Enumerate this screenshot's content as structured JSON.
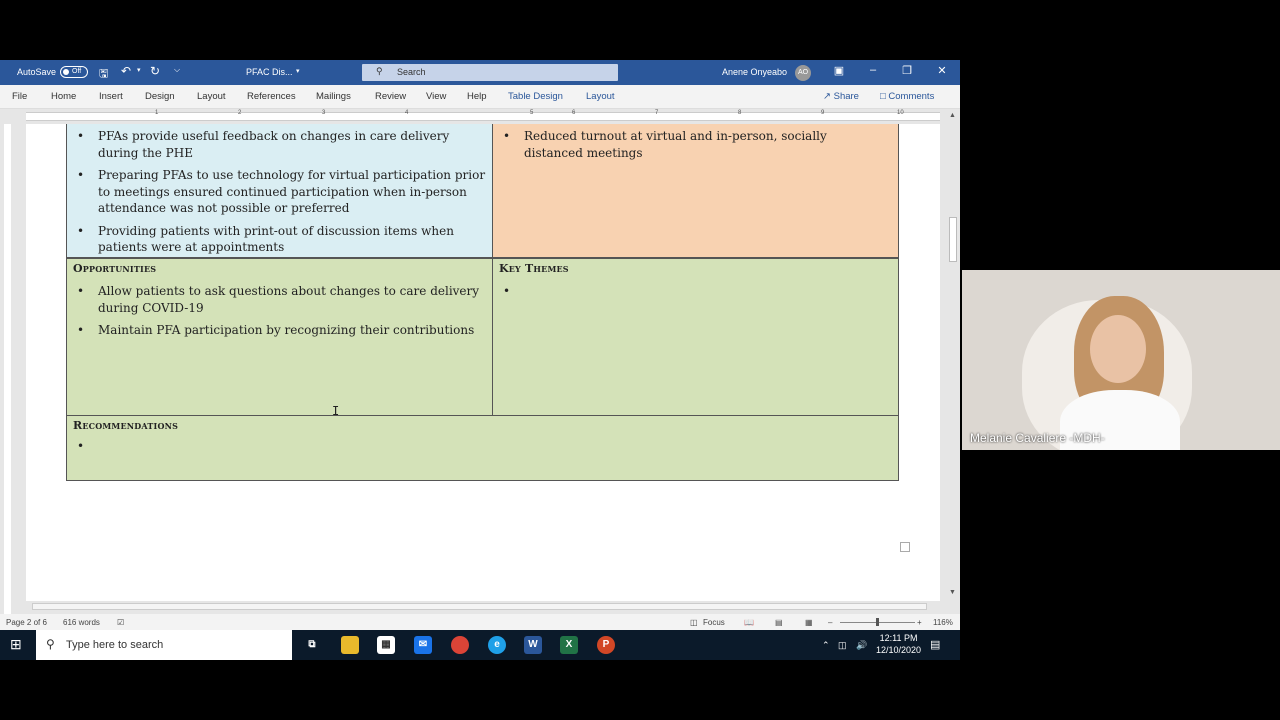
{
  "titlebar": {
    "autosave": "AutoSave",
    "autosave_state": "Off",
    "doc_name": "PFAC Dis...",
    "search_placeholder": "Search",
    "user_name": "Anene Onyeabo",
    "user_initials": "AO"
  },
  "ribbon": {
    "tabs": [
      "File",
      "Home",
      "Insert",
      "Design",
      "Layout",
      "References",
      "Mailings",
      "Review",
      "View",
      "Help",
      "Table Design",
      "Layout"
    ],
    "share": "Share",
    "comments": "Comments"
  },
  "ruler_numbers": [
    "1",
    "2",
    "3",
    "4",
    "5",
    "6",
    "7",
    "8",
    "9",
    "10"
  ],
  "document": {
    "strengths_items": [
      "PFAs provide useful feedback on changes in care delivery during the PHE",
      "Preparing PFAs to use technology for virtual participation prior to meetings ensured continued participation when in-person attendance was not possible or preferred",
      "Providing patients with print-out of discussion items when patients were at appointments"
    ],
    "weaknesses_items": [
      "Reduced turnout at virtual and in-person, socially distanced meetings"
    ],
    "opportunities_header": "Opportunities",
    "opportunities_items": [
      "Allow patients to ask questions about changes to care delivery during COVID-19",
      "Maintain PFA participation by recognizing their contributions"
    ],
    "key_themes_header": "Key Themes",
    "recommendations_header": "Recommendations"
  },
  "statusbar": {
    "page": "Page 2 of 6",
    "words": "616 words",
    "focus": "Focus",
    "zoom": "116%"
  },
  "taskbar": {
    "search_placeholder": "Type here to search",
    "time": "12:11 PM",
    "date": "12/10/2020"
  },
  "video": {
    "participant_name": "Melanie Cavaliere -MDH-"
  },
  "colors": {
    "word_blue": "#2b579a",
    "strengths_bg": "#daeef3",
    "weaknesses_bg": "#f8d2b1",
    "green_bg": "#d4e2b8"
  }
}
